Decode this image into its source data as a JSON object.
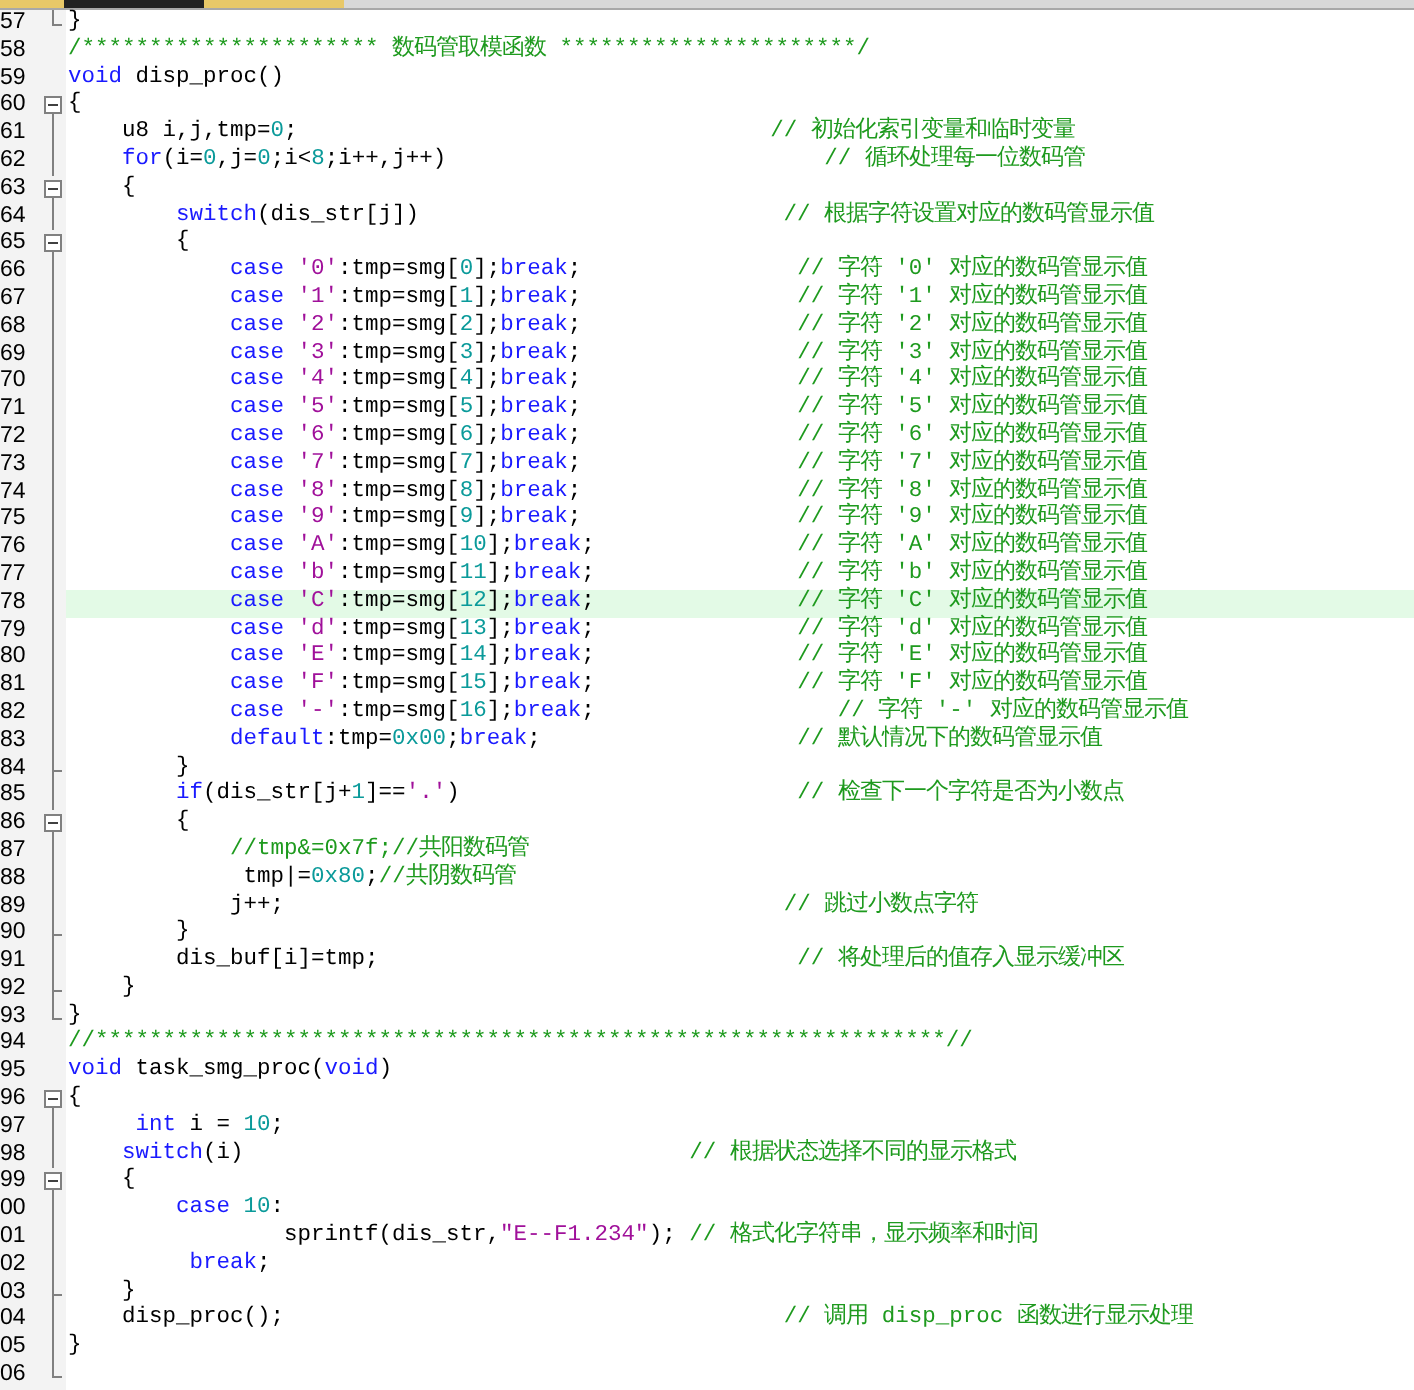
{
  "editor": {
    "lines": [
      {
        "number": "57",
        "kind": "fold_last",
        "current": false,
        "tokens": [
          {
            "kind": "txt",
            "text": "}"
          }
        ]
      },
      {
        "number": "58",
        "kind": "plain",
        "current": false,
        "tokens": [
          {
            "kind": "cmt",
            "text": "/********************** 数码管取模函数 **********************/"
          }
        ]
      },
      {
        "number": "59",
        "kind": "plain",
        "current": false,
        "tokens": [
          {
            "kind": "kw",
            "text": "void"
          },
          {
            "kind": "txt",
            "text": " disp_proc()"
          }
        ]
      },
      {
        "number": "60",
        "kind": "fold_start",
        "current": false,
        "tokens": [
          {
            "kind": "txt",
            "text": "{"
          }
        ]
      },
      {
        "number": "61",
        "kind": "fold_inner",
        "current": false,
        "tokens": [
          {
            "kind": "txt",
            "text": "    u8 i,j,tmp="
          },
          {
            "kind": "num",
            "text": "0"
          },
          {
            "kind": "txt",
            "text": ";"
          },
          {
            "kind": "cmt",
            "text": "                                   // 初始化索引变量和临时变量"
          }
        ]
      },
      {
        "number": "62",
        "kind": "fold_inner",
        "current": false,
        "tokens": [
          {
            "kind": "kw",
            "text": "    for"
          },
          {
            "kind": "txt",
            "text": "(i="
          },
          {
            "kind": "num",
            "text": "0"
          },
          {
            "kind": "txt",
            "text": ",j="
          },
          {
            "kind": "num",
            "text": "0"
          },
          {
            "kind": "txt",
            "text": ";i<"
          },
          {
            "kind": "num",
            "text": "8"
          },
          {
            "kind": "txt",
            "text": ";i++,j++)"
          },
          {
            "kind": "cmt",
            "text": "                            // 循环处理每一位数码管"
          }
        ]
      },
      {
        "number": "63",
        "kind": "fold_start",
        "current": false,
        "tokens": [
          {
            "kind": "txt",
            "text": "    {"
          }
        ]
      },
      {
        "number": "64",
        "kind": "fold_inner",
        "current": false,
        "tokens": [
          {
            "kind": "kw",
            "text": "        switch"
          },
          {
            "kind": "txt",
            "text": "(dis_str[j])"
          },
          {
            "kind": "cmt",
            "text": "                           // 根据字符设置对应的数码管显示值"
          }
        ]
      },
      {
        "number": "65",
        "kind": "fold_start",
        "current": false,
        "tokens": [
          {
            "kind": "txt",
            "text": "        {"
          }
        ]
      },
      {
        "number": "66",
        "kind": "fold_inner",
        "current": false,
        "tokens": [
          {
            "kind": "kw",
            "text": "            case"
          },
          {
            "kind": "chr",
            "text": " '0'"
          },
          {
            "kind": "txt",
            "text": ":tmp=smg["
          },
          {
            "kind": "num",
            "text": "0"
          },
          {
            "kind": "txt",
            "text": "];"
          },
          {
            "kind": "kw",
            "text": "break"
          },
          {
            "kind": "txt",
            "text": ";"
          },
          {
            "kind": "cmt",
            "text": "                // 字符 '0' 对应的数码管显示值"
          }
        ]
      },
      {
        "number": "67",
        "kind": "fold_inner",
        "current": false,
        "tokens": [
          {
            "kind": "kw",
            "text": "            case"
          },
          {
            "kind": "chr",
            "text": " '1'"
          },
          {
            "kind": "txt",
            "text": ":tmp=smg["
          },
          {
            "kind": "num",
            "text": "1"
          },
          {
            "kind": "txt",
            "text": "];"
          },
          {
            "kind": "kw",
            "text": "break"
          },
          {
            "kind": "txt",
            "text": ";"
          },
          {
            "kind": "cmt",
            "text": "                // 字符 '1' 对应的数码管显示值"
          }
        ]
      },
      {
        "number": "68",
        "kind": "fold_inner",
        "current": false,
        "tokens": [
          {
            "kind": "kw",
            "text": "            case"
          },
          {
            "kind": "chr",
            "text": " '2'"
          },
          {
            "kind": "txt",
            "text": ":tmp=smg["
          },
          {
            "kind": "num",
            "text": "2"
          },
          {
            "kind": "txt",
            "text": "];"
          },
          {
            "kind": "kw",
            "text": "break"
          },
          {
            "kind": "txt",
            "text": ";"
          },
          {
            "kind": "cmt",
            "text": "                // 字符 '2' 对应的数码管显示值"
          }
        ]
      },
      {
        "number": "69",
        "kind": "fold_inner",
        "current": false,
        "tokens": [
          {
            "kind": "kw",
            "text": "            case"
          },
          {
            "kind": "chr",
            "text": " '3'"
          },
          {
            "kind": "txt",
            "text": ":tmp=smg["
          },
          {
            "kind": "num",
            "text": "3"
          },
          {
            "kind": "txt",
            "text": "];"
          },
          {
            "kind": "kw",
            "text": "break"
          },
          {
            "kind": "txt",
            "text": ";"
          },
          {
            "kind": "cmt",
            "text": "                // 字符 '3' 对应的数码管显示值"
          }
        ]
      },
      {
        "number": "70",
        "kind": "fold_inner",
        "current": false,
        "tokens": [
          {
            "kind": "kw",
            "text": "            case"
          },
          {
            "kind": "chr",
            "text": " '4'"
          },
          {
            "kind": "txt",
            "text": ":tmp=smg["
          },
          {
            "kind": "num",
            "text": "4"
          },
          {
            "kind": "txt",
            "text": "];"
          },
          {
            "kind": "kw",
            "text": "break"
          },
          {
            "kind": "txt",
            "text": ";"
          },
          {
            "kind": "cmt",
            "text": "                // 字符 '4' 对应的数码管显示值"
          }
        ]
      },
      {
        "number": "71",
        "kind": "fold_inner",
        "current": false,
        "tokens": [
          {
            "kind": "kw",
            "text": "            case"
          },
          {
            "kind": "chr",
            "text": " '5'"
          },
          {
            "kind": "txt",
            "text": ":tmp=smg["
          },
          {
            "kind": "num",
            "text": "5"
          },
          {
            "kind": "txt",
            "text": "];"
          },
          {
            "kind": "kw",
            "text": "break"
          },
          {
            "kind": "txt",
            "text": ";"
          },
          {
            "kind": "cmt",
            "text": "                // 字符 '5' 对应的数码管显示值"
          }
        ]
      },
      {
        "number": "72",
        "kind": "fold_inner",
        "current": false,
        "tokens": [
          {
            "kind": "kw",
            "text": "            case"
          },
          {
            "kind": "chr",
            "text": " '6'"
          },
          {
            "kind": "txt",
            "text": ":tmp=smg["
          },
          {
            "kind": "num",
            "text": "6"
          },
          {
            "kind": "txt",
            "text": "];"
          },
          {
            "kind": "kw",
            "text": "break"
          },
          {
            "kind": "txt",
            "text": ";"
          },
          {
            "kind": "cmt",
            "text": "                // 字符 '6' 对应的数码管显示值"
          }
        ]
      },
      {
        "number": "73",
        "kind": "fold_inner",
        "current": false,
        "tokens": [
          {
            "kind": "kw",
            "text": "            case"
          },
          {
            "kind": "chr",
            "text": " '7'"
          },
          {
            "kind": "txt",
            "text": ":tmp=smg["
          },
          {
            "kind": "num",
            "text": "7"
          },
          {
            "kind": "txt",
            "text": "];"
          },
          {
            "kind": "kw",
            "text": "break"
          },
          {
            "kind": "txt",
            "text": ";"
          },
          {
            "kind": "cmt",
            "text": "                // 字符 '7' 对应的数码管显示值"
          }
        ]
      },
      {
        "number": "74",
        "kind": "fold_inner",
        "current": false,
        "tokens": [
          {
            "kind": "kw",
            "text": "            case"
          },
          {
            "kind": "chr",
            "text": " '8'"
          },
          {
            "kind": "txt",
            "text": ":tmp=smg["
          },
          {
            "kind": "num",
            "text": "8"
          },
          {
            "kind": "txt",
            "text": "];"
          },
          {
            "kind": "kw",
            "text": "break"
          },
          {
            "kind": "txt",
            "text": ";"
          },
          {
            "kind": "cmt",
            "text": "                // 字符 '8' 对应的数码管显示值"
          }
        ]
      },
      {
        "number": "75",
        "kind": "fold_inner",
        "current": false,
        "tokens": [
          {
            "kind": "kw",
            "text": "            case"
          },
          {
            "kind": "chr",
            "text": " '9'"
          },
          {
            "kind": "txt",
            "text": ":tmp=smg["
          },
          {
            "kind": "num",
            "text": "9"
          },
          {
            "kind": "txt",
            "text": "];"
          },
          {
            "kind": "kw",
            "text": "break"
          },
          {
            "kind": "txt",
            "text": ";"
          },
          {
            "kind": "cmt",
            "text": "                // 字符 '9' 对应的数码管显示值"
          }
        ]
      },
      {
        "number": "76",
        "kind": "fold_inner",
        "current": false,
        "tokens": [
          {
            "kind": "kw",
            "text": "            case"
          },
          {
            "kind": "chr",
            "text": " 'A'"
          },
          {
            "kind": "txt",
            "text": ":tmp=smg["
          },
          {
            "kind": "num",
            "text": "10"
          },
          {
            "kind": "txt",
            "text": "];"
          },
          {
            "kind": "kw",
            "text": "break"
          },
          {
            "kind": "txt",
            "text": ";"
          },
          {
            "kind": "cmt",
            "text": "               // 字符 'A' 对应的数码管显示值"
          }
        ]
      },
      {
        "number": "77",
        "kind": "fold_inner",
        "current": false,
        "tokens": [
          {
            "kind": "kw",
            "text": "            case"
          },
          {
            "kind": "chr",
            "text": " 'b'"
          },
          {
            "kind": "txt",
            "text": ":tmp=smg["
          },
          {
            "kind": "num",
            "text": "11"
          },
          {
            "kind": "txt",
            "text": "];"
          },
          {
            "kind": "kw",
            "text": "break"
          },
          {
            "kind": "txt",
            "text": ";"
          },
          {
            "kind": "cmt",
            "text": "               // 字符 'b' 对应的数码管显示值"
          }
        ]
      },
      {
        "number": "78",
        "kind": "fold_inner",
        "current": true,
        "tokens": [
          {
            "kind": "kw",
            "text": "            case"
          },
          {
            "kind": "chr",
            "text": " 'C'"
          },
          {
            "kind": "txt",
            "text": ":tmp=smg["
          },
          {
            "kind": "num",
            "text": "12"
          },
          {
            "kind": "txt",
            "text": "];"
          },
          {
            "kind": "kw",
            "text": "break"
          },
          {
            "kind": "txt",
            "text": ";"
          },
          {
            "kind": "cmt",
            "text": "               // 字符 'C' 对应的数码管显示值"
          }
        ]
      },
      {
        "number": "79",
        "kind": "fold_inner",
        "current": false,
        "tokens": [
          {
            "kind": "kw",
            "text": "            case"
          },
          {
            "kind": "chr",
            "text": " 'd'"
          },
          {
            "kind": "txt",
            "text": ":tmp=smg["
          },
          {
            "kind": "num",
            "text": "13"
          },
          {
            "kind": "txt",
            "text": "];"
          },
          {
            "kind": "kw",
            "text": "break"
          },
          {
            "kind": "txt",
            "text": ";"
          },
          {
            "kind": "cmt",
            "text": "               // 字符 'd' 对应的数码管显示值"
          }
        ]
      },
      {
        "number": "80",
        "kind": "fold_inner",
        "current": false,
        "tokens": [
          {
            "kind": "kw",
            "text": "            case"
          },
          {
            "kind": "chr",
            "text": " 'E'"
          },
          {
            "kind": "txt",
            "text": ":tmp=smg["
          },
          {
            "kind": "num",
            "text": "14"
          },
          {
            "kind": "txt",
            "text": "];"
          },
          {
            "kind": "kw",
            "text": "break"
          },
          {
            "kind": "txt",
            "text": ";"
          },
          {
            "kind": "cmt",
            "text": "               // 字符 'E' 对应的数码管显示值"
          }
        ]
      },
      {
        "number": "81",
        "kind": "fold_inner",
        "current": false,
        "tokens": [
          {
            "kind": "kw",
            "text": "            case"
          },
          {
            "kind": "chr",
            "text": " 'F'"
          },
          {
            "kind": "txt",
            "text": ":tmp=smg["
          },
          {
            "kind": "num",
            "text": "15"
          },
          {
            "kind": "txt",
            "text": "];"
          },
          {
            "kind": "kw",
            "text": "break"
          },
          {
            "kind": "txt",
            "text": ";"
          },
          {
            "kind": "cmt",
            "text": "               // 字符 'F' 对应的数码管显示值"
          }
        ]
      },
      {
        "number": "82",
        "kind": "fold_inner",
        "current": false,
        "tokens": [
          {
            "kind": "kw",
            "text": "            case"
          },
          {
            "kind": "chr",
            "text": " '-'"
          },
          {
            "kind": "txt",
            "text": ":tmp=smg["
          },
          {
            "kind": "num",
            "text": "16"
          },
          {
            "kind": "txt",
            "text": "];"
          },
          {
            "kind": "kw",
            "text": "break"
          },
          {
            "kind": "txt",
            "text": ";"
          },
          {
            "kind": "cmt",
            "text": "                  // 字符 '-' 对应的数码管显示值"
          }
        ]
      },
      {
        "number": "83",
        "kind": "fold_inner",
        "current": false,
        "tokens": [
          {
            "kind": "kw",
            "text": "            default"
          },
          {
            "kind": "txt",
            "text": ":tmp="
          },
          {
            "kind": "num",
            "text": "0x00"
          },
          {
            "kind": "txt",
            "text": ";"
          },
          {
            "kind": "kw",
            "text": "break"
          },
          {
            "kind": "txt",
            "text": ";"
          },
          {
            "kind": "cmt",
            "text": "                   // 默认情况下的数码管显示值"
          }
        ]
      },
      {
        "number": "84",
        "kind": "fold_end",
        "current": false,
        "tokens": [
          {
            "kind": "txt",
            "text": "        }"
          }
        ]
      },
      {
        "number": "85",
        "kind": "fold_inner",
        "current": false,
        "tokens": [
          {
            "kind": "kw",
            "text": "        if"
          },
          {
            "kind": "txt",
            "text": "(dis_str[j+"
          },
          {
            "kind": "num",
            "text": "1"
          },
          {
            "kind": "txt",
            "text": "]=="
          },
          {
            "kind": "chr",
            "text": "'.'"
          },
          {
            "kind": "txt",
            "text": ")"
          },
          {
            "kind": "cmt",
            "text": "                         // 检查下一个字符是否为小数点"
          }
        ]
      },
      {
        "number": "86",
        "kind": "fold_start",
        "current": false,
        "tokens": [
          {
            "kind": "txt",
            "text": "        {"
          }
        ]
      },
      {
        "number": "87",
        "kind": "fold_inner",
        "current": false,
        "tokens": [
          {
            "kind": "cmt",
            "text": "            //tmp&=0x7f;//共阳数码管"
          }
        ]
      },
      {
        "number": "88",
        "kind": "fold_inner",
        "current": false,
        "tokens": [
          {
            "kind": "txt",
            "text": "             tmp|="
          },
          {
            "kind": "num",
            "text": "0x80"
          },
          {
            "kind": "txt",
            "text": ";"
          },
          {
            "kind": "cmt",
            "text": "//共阴数码管"
          }
        ]
      },
      {
        "number": "89",
        "kind": "fold_inner",
        "current": false,
        "tokens": [
          {
            "kind": "txt",
            "text": "            j++;"
          },
          {
            "kind": "cmt",
            "text": "                                     // 跳过小数点字符"
          }
        ]
      },
      {
        "number": "90",
        "kind": "fold_end",
        "current": false,
        "tokens": [
          {
            "kind": "txt",
            "text": "        }"
          }
        ]
      },
      {
        "number": "91",
        "kind": "fold_inner",
        "current": false,
        "tokens": [
          {
            "kind": "txt",
            "text": "        dis_buf[i]=tmp;"
          },
          {
            "kind": "cmt",
            "text": "                               // 将处理后的值存入显示缓冲区"
          }
        ]
      },
      {
        "number": "92",
        "kind": "fold_end",
        "current": false,
        "tokens": [
          {
            "kind": "txt",
            "text": "    }"
          }
        ]
      },
      {
        "number": "93",
        "kind": "fold_last",
        "current": false,
        "tokens": [
          {
            "kind": "txt",
            "text": "}"
          }
        ]
      },
      {
        "number": "94",
        "kind": "plain",
        "current": false,
        "tokens": [
          {
            "kind": "cmt",
            "text": "//***************************************************************//"
          }
        ]
      },
      {
        "number": "95",
        "kind": "plain",
        "current": false,
        "tokens": [
          {
            "kind": "kw",
            "text": "void"
          },
          {
            "kind": "txt",
            "text": " task_smg_proc("
          },
          {
            "kind": "kw",
            "text": "void"
          },
          {
            "kind": "txt",
            "text": ")"
          }
        ]
      },
      {
        "number": "96",
        "kind": "fold_start",
        "current": false,
        "tokens": [
          {
            "kind": "txt",
            "text": "{"
          }
        ]
      },
      {
        "number": "97",
        "kind": "fold_inner",
        "current": false,
        "tokens": [
          {
            "kind": "kw",
            "text": "     int"
          },
          {
            "kind": "txt",
            "text": " i = "
          },
          {
            "kind": "num",
            "text": "10"
          },
          {
            "kind": "txt",
            "text": ";"
          }
        ]
      },
      {
        "number": "98",
        "kind": "fold_inner",
        "current": false,
        "tokens": [
          {
            "kind": "kw",
            "text": "    switch"
          },
          {
            "kind": "txt",
            "text": "(i)"
          },
          {
            "kind": "cmt",
            "text": "                                 // 根据状态选择不同的显示格式"
          }
        ]
      },
      {
        "number": "99",
        "kind": "fold_start",
        "current": false,
        "tokens": [
          {
            "kind": "txt",
            "text": "    {"
          }
        ]
      },
      {
        "number": "00",
        "kind": "fold_inner",
        "current": false,
        "tokens": [
          {
            "kind": "kw",
            "text": "        case"
          },
          {
            "kind": "num",
            "text": " 10"
          },
          {
            "kind": "txt",
            "text": ":"
          }
        ]
      },
      {
        "number": "01",
        "kind": "fold_inner",
        "current": false,
        "tokens": [
          {
            "kind": "txt",
            "text": "                sprintf(dis_str,"
          },
          {
            "kind": "str",
            "text": "\"E--F1.234\""
          },
          {
            "kind": "txt",
            "text": ");"
          },
          {
            "kind": "cmt",
            "text": " // 格式化字符串，显示频率和时间"
          }
        ]
      },
      {
        "number": "02",
        "kind": "fold_inner",
        "current": false,
        "tokens": [
          {
            "kind": "kw",
            "text": "         break"
          },
          {
            "kind": "txt",
            "text": ";"
          }
        ]
      },
      {
        "number": "03",
        "kind": "fold_end",
        "current": false,
        "tokens": [
          {
            "kind": "txt",
            "text": "    }"
          }
        ]
      },
      {
        "number": "04",
        "kind": "fold_inner",
        "current": false,
        "tokens": [
          {
            "kind": "txt",
            "text": "    disp_proc();"
          },
          {
            "kind": "cmt",
            "text": "                                     // 调用 disp_proc 函数进行显示处理"
          }
        ]
      },
      {
        "number": "05",
        "kind": "fold_inner",
        "current": false,
        "tokens": [
          {
            "kind": "txt",
            "text": "}"
          }
        ]
      },
      {
        "number": "06",
        "kind": "fold_last",
        "current": false
      }
    ]
  }
}
